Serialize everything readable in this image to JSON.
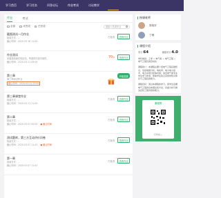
{
  "nav": {
    "tabs": [
      "学习首页",
      "学习任务",
      "问答论坛",
      "作业考试",
      "讨论教学"
    ],
    "active_index": 3
  },
  "subtabs": [
    "作业",
    "考试"
  ],
  "filters": [
    "全部",
    "未完成",
    "已完成"
  ],
  "search": {
    "placeholder": "搜索人员或作业"
  },
  "tasks": [
    {
      "title": "截图测试一月作业",
      "meta1": "批阅方式：--",
      "meta2": "截止时间：2020.03.16 11:00",
      "status": "已批改",
      "btn": "查看作业"
    },
    {
      "title": "作业测试",
      "meta1": "本题是给我们的反馈，所提供内容可用的，",
      "meta2": "截止时间：2020.03.11 09:00",
      "score": "70",
      "unit": "分",
      "btn": "查看作业"
    },
    {
      "title": "第三章",
      "meta1": "第三章测试作业",
      "meta2": "截止时间：2020.03.11 23:59",
      "btn": "开始答题"
    },
    {
      "title": "第三章课堂作业",
      "meta1": "批阅方式：--",
      "meta2": "截止时间：2020.03.11 11:00",
      "status": "已批改",
      "btn": "查看作业"
    },
    {
      "title": "第二章",
      "meta1": "批阅方式：--",
      "meta2": "截止时间：2020.03.07 00:00",
      "status": "已批改",
      "flag": "● 截止时间",
      "btn": "查看作业"
    },
    {
      "title": "测试题库，第三方互动评价问卷",
      "meta1": "批阅方式：--",
      "meta2": "截止时间：2020.03.07 11:43",
      "status": "已批改",
      "flag": "● 截止时间",
      "btn": "查看作业"
    },
    {
      "title": "第一章",
      "meta1": "批阅方式：--",
      "meta2": "截止时间：2020.03.07 11:43",
      "status": "已批改",
      "btn": "查看作业"
    }
  ],
  "side": {
    "teachers_title": "授课老师",
    "teachers": [
      "张晓宇",
      "丁明"
    ],
    "intro_title": "课程介绍",
    "stat1_label": "学分",
    "stat1_value": "64",
    "stat2_label": "课程评分",
    "stat2_value": "4.0",
    "desc1": "学科类别：工学 > 电气类 > 电气工程 > 电气工程及其自动化",
    "desc2": "课程简介：本课程主要介绍电气工程基础知识，包括电路分析、电机学、电力电子技术、电力系统分析等内容，适合电气类专业学生学习参考，帮助学生建立完整的知识体系与工程实践能力。",
    "desc3": "课程目标：通过本课程的学习，使学生掌握电气工程的基本理论和方法，具备分析与解决实际工程问题的能力。",
    "qr_title": "课程群",
    "qr_foot": "扫码加入"
  }
}
